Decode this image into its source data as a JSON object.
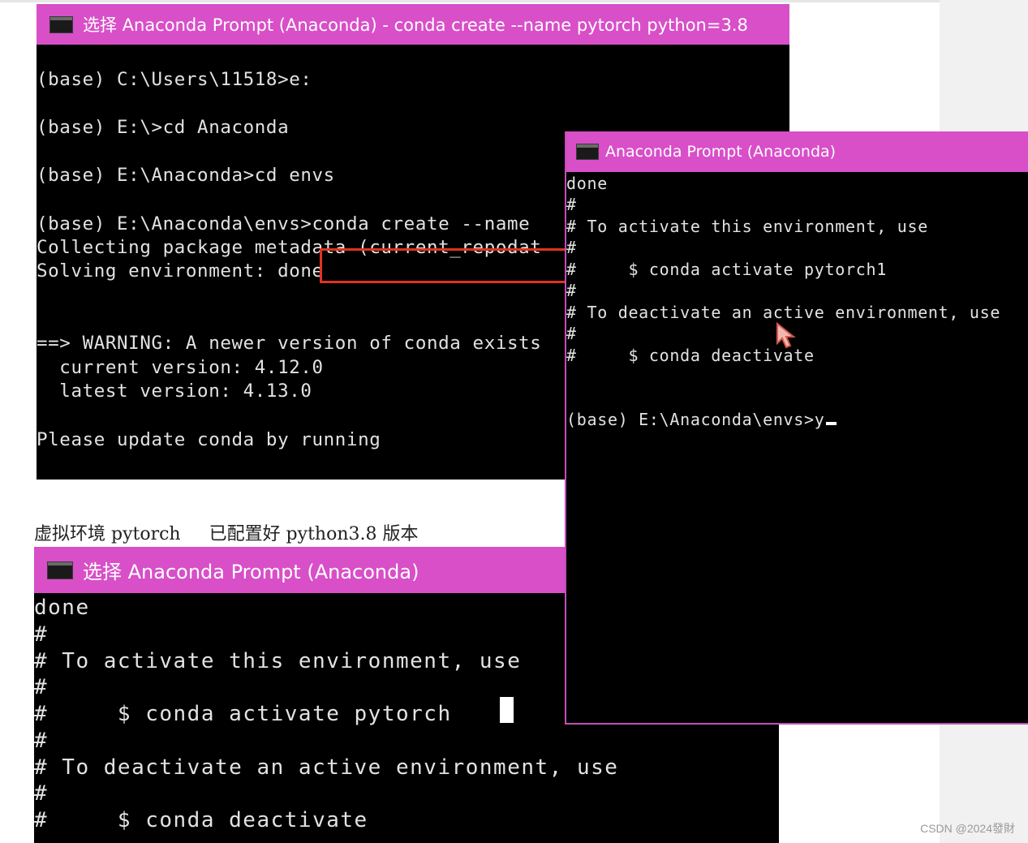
{
  "window1": {
    "title": "选择 Anaconda Prompt (Anaconda) - conda  create --name pytorch python=3.8",
    "lines": [
      "(base) C:\\Users\\11518>e:",
      "(base) E:\\>cd Anaconda",
      "(base) E:\\Anaconda>cd envs",
      "(base) E:\\Anaconda\\envs>conda create --name",
      "Collecting package metadata (current_repodat",
      "Solving environment: done",
      "==> WARNING: A newer version of conda exists",
      "  current version: 4.12.0",
      "  latest version: 4.13.0",
      "Please update conda by running"
    ]
  },
  "window2": {
    "title": "Anaconda Prompt (Anaconda)",
    "lines": [
      "done",
      "#",
      "# To activate this environment, use",
      "#",
      "#     $ conda activate pytorch1",
      "#",
      "# To deactivate an active environment, use",
      "#",
      "#     $ conda deactivate",
      "(base) E:\\Anaconda\\envs>y"
    ]
  },
  "window3": {
    "title": "选择 Anaconda Prompt (Anaconda)",
    "lines": [
      "done",
      "#",
      "# To activate this environment, use",
      "#",
      "#     $ conda activate pytorch",
      "#",
      "# To deactivate an active environment, use",
      "#",
      "#     $ conda deactivate"
    ]
  },
  "caption": "虚拟环境 pytorch     已配置好 python3.8 版本",
  "watermark": "CSDN @2024發財",
  "colors": {
    "titlebar": "#d84fc8",
    "terminal_bg": "#000000",
    "terminal_text": "#e2e2e2",
    "highlight_box": "#e0341f"
  },
  "icons": {
    "window_icon": "console-icon",
    "pointer": "mouse-pointer-icon"
  }
}
